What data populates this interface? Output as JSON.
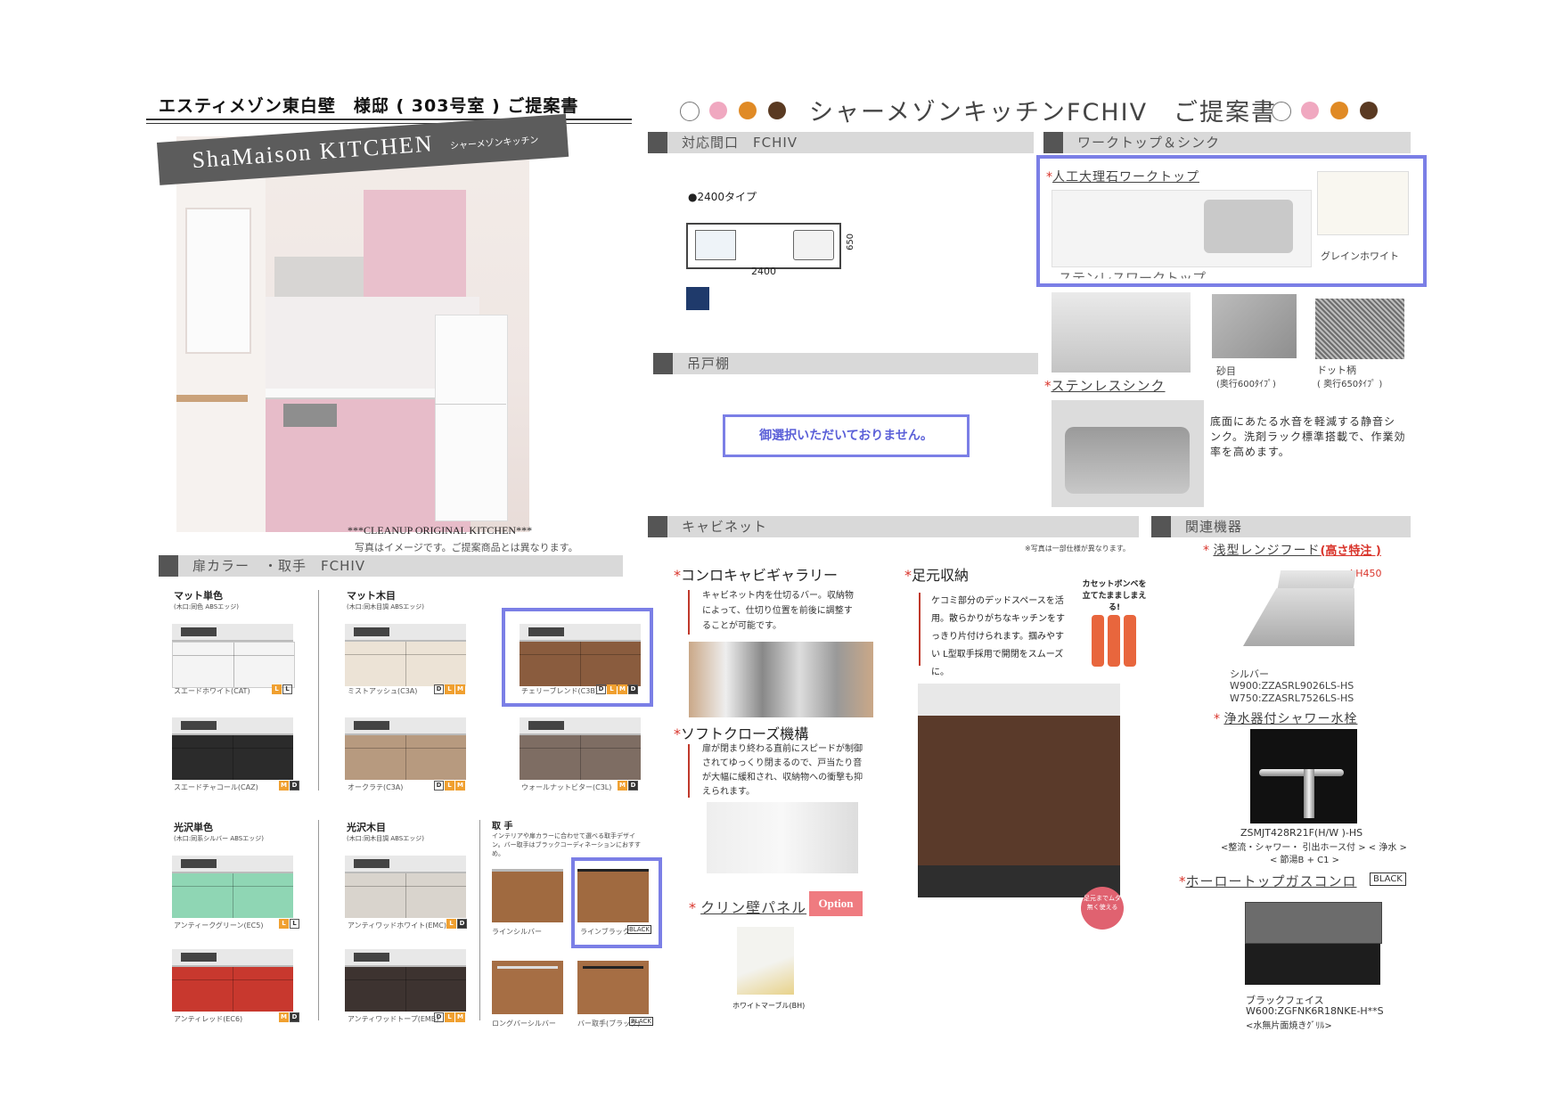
{
  "header_left": {
    "title": "エスティメゾン東白壁　様邸 ( 303号室 ) ご提案書"
  },
  "header_right": {
    "title": "シャーメゾンキッチンFCHIV　ご提案書",
    "dots": [
      "#ffffff",
      "#f0a8c0",
      "#e08a25",
      "#5a3a22"
    ]
  },
  "hero": {
    "banner": "ShaMaison KITCHEN",
    "banner_sub": "シャーメゾンキッチン",
    "caption1": "***CLEANUP ORIGINAL KITCHEN***",
    "caption2": "写真はイメージです。ご提案商品とは異なります。"
  },
  "door": {
    "section": "扉カラー　・取手　FCHIV",
    "groups": [
      {
        "title": "マット単色",
        "sub": "(木口:同色 ABSエッジ)"
      },
      {
        "title": "マット木目",
        "sub": "(木口:同木目調 ABSエッジ)"
      },
      {
        "title": "光沢単色",
        "sub": "(木口:同系シルバー ABSエッジ)"
      },
      {
        "title": "光沢木目",
        "sub": "(木口:同木目調 ABSエッジ)"
      },
      {
        "title": "取 手",
        "sub": "インテリアや扉カラーに合わせて選べる取手デザイン。バー取手はブラックコーディネーションにおすすめ。"
      }
    ],
    "items": [
      {
        "label": "スエードホワイト(CAT)",
        "badges": "LL"
      },
      {
        "label": "ミストアッシュ(C3A)",
        "badges": "DLM"
      },
      {
        "label": "チェリーブレンド(C3B)",
        "badges": "DLMD"
      },
      {
        "label": "スエードチャコール(CAZ)",
        "badges": "MD"
      },
      {
        "label": "オークラテ(C3A)",
        "badges": "DLM"
      },
      {
        "label": "ウォールナットビター(C3L)",
        "badges": "MD"
      },
      {
        "label": "アンティークグリーン(EC5)",
        "badges": "LL"
      },
      {
        "label": "アンティワッドホワイト(EMC)",
        "badges": "LD"
      },
      {
        "label": "アンティレッド(EC6)",
        "badges": "MD"
      },
      {
        "label": "アンティワッドトープ(EMB)",
        "badges": "DLM"
      }
    ],
    "handles": [
      {
        "label": "ラインシルバー"
      },
      {
        "label": "ラインブラック",
        "tag": "BLACK"
      },
      {
        "label": "ロングバーシルバー"
      },
      {
        "label": "バー取手(ブラック)",
        "tag": "BLACK"
      }
    ]
  },
  "frontage": {
    "section": "対応間口　FCHIV",
    "type": "●2400タイプ",
    "width": "2400",
    "depth": "650"
  },
  "wall_cabinet": {
    "section": "吊戸棚",
    "message": "御選択いただいておりません。"
  },
  "worktop": {
    "section": "ワークトップ＆シンク",
    "marble_title": "人工大理石ワークトップ",
    "marble_color": "グレインホワイト",
    "stainless_title": "ステンレスワークトップ",
    "sand_label": "砂目",
    "sand_sub": "(奥行600ﾀｲﾌﾟ)",
    "dot_label": "ドット柄",
    "dot_sub": "( 奥行650ﾀｲﾌﾟ )",
    "sink_title": "ステンレスシンク",
    "sink_desc": "底面にあたる水音を軽減する静音シンク。洗剤ラック標準搭載で、作業効率を高めます。"
  },
  "cabinet": {
    "section": "キャビネット",
    "note": "※写真は一部仕様が異なります。",
    "gallery_title": "コンロキャビギャラリー",
    "gallery_desc": "キャビネット内を仕切るバー。収納物によって、仕切り位置を前後に調整することが可能です。",
    "soft_title": "ソフトクローズ機構",
    "soft_desc": "扉が閉まり終わる直前にスピードが制御されてゆっくり閉まるので、戸当たり音が大幅に緩和され、収納物への衝撃も抑えられます。",
    "foot_title": "足元収納",
    "foot_desc": "ケコミ部分のデッドスペースを活用。散らかりがちなキッチンをすっきり片付けられます。掴みやすい L型取手採用で開閉をスムーズに。",
    "cassette": "カセットボンベを立てたまましまえる!",
    "foot_badge": "足元までムダ無く使える",
    "panel_title": "クリン壁パネル",
    "panel_option": "Option",
    "panel_color": "ホワイトマーブル(BH)"
  },
  "equipment": {
    "section": "関連機器",
    "hood_title": "浅型レンジフード",
    "hood_note": "(高さ特注 )",
    "hood_h": "※H450",
    "hood_color": "シルバー",
    "hood_w900": "W900:ZZASRL9026LS-HS",
    "hood_w750": "W750:ZZASRL7526LS-HS",
    "faucet_title": "浄水器付シャワー水栓",
    "faucet_model": "ZSMJT428R21F(H/W )-HS",
    "faucet_desc1": "<整流・シャワー・ 引出ホース付 > < 浄水 >",
    "faucet_desc2": "< 節湯B + C1 >",
    "stove_title": "ホーロートップガスコンロ",
    "stove_tag": "BLACK",
    "stove_color": "ブラックフェイス",
    "stove_model": "W600:ZGFNK6R18NKE-H**S",
    "stove_desc": "<水無片面焼きｸﾞﾘﾙ>"
  }
}
